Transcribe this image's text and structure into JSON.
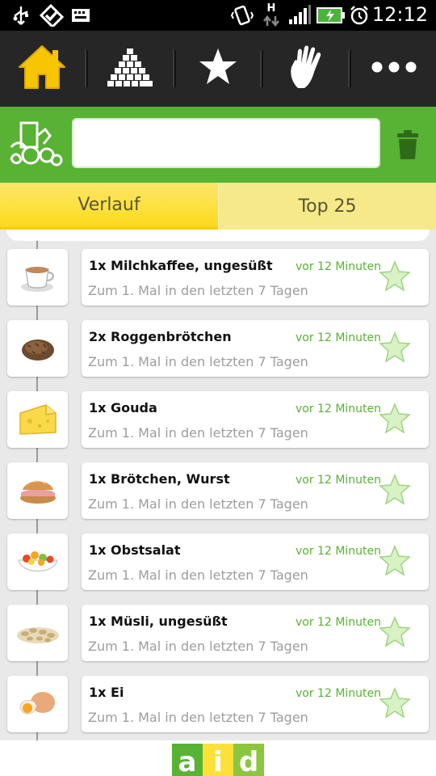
{
  "status_bar": {
    "time": "12:12",
    "network_label": "H",
    "icons": [
      "usb-icon",
      "tasks-check-icon",
      "keyboard-icon",
      "vibrate-icon",
      "data-arrows-icon",
      "signal-icon",
      "battery-charging-icon",
      "alarm-icon"
    ]
  },
  "nav": {
    "items": [
      {
        "name": "home-icon",
        "active": true
      },
      {
        "name": "food-pyramid-icon",
        "active": false
      },
      {
        "name": "star-icon",
        "active": false
      },
      {
        "name": "hand-icon",
        "active": false
      },
      {
        "name": "more-dots-icon",
        "active": false
      }
    ]
  },
  "search": {
    "value": "",
    "placeholder": "",
    "logo_icon": "food-basket-icon",
    "trash_icon": "trash-icon"
  },
  "tabs": [
    {
      "label": "Verlauf",
      "active": true
    },
    {
      "label": "Top 25",
      "active": false
    }
  ],
  "colors": {
    "green": "#58b233",
    "yellow": "#fde13a",
    "nav_bg": "#262626",
    "subtle_text": "#9d9d9d"
  },
  "entries": [
    {
      "title": "1x Milchkaffee, ungesüßt",
      "time": "vor 12 Minuten",
      "subtitle": "Zum 1. Mal in den letzten 7 Tagen",
      "image": "coffee-icon"
    },
    {
      "title": "2x Roggenbrötchen",
      "time": "vor 12 Minuten",
      "subtitle": "Zum 1. Mal in den letzten 7 Tagen",
      "image": "rye-roll-icon"
    },
    {
      "title": "1x Gouda",
      "time": "vor 12 Minuten",
      "subtitle": "Zum 1. Mal in den letzten 7 Tagen",
      "image": "cheese-icon"
    },
    {
      "title": "1x Brötchen, Wurst",
      "time": "vor 12 Minuten",
      "subtitle": "Zum 1. Mal in den letzten 7 Tagen",
      "image": "sandwich-icon"
    },
    {
      "title": "1x Obstsalat",
      "time": "vor 12 Minuten",
      "subtitle": "Zum 1. Mal in den letzten 7 Tagen",
      "image": "fruit-salad-icon"
    },
    {
      "title": "1x Müsli, ungesüßt",
      "time": "vor 12 Minuten",
      "subtitle": "Zum 1. Mal in den letzten 7 Tagen",
      "image": "muesli-icon"
    },
    {
      "title": "1x Ei",
      "time": "vor 12 Minuten",
      "subtitle": "Zum 1. Mal in den letzten 7 Tagen",
      "image": "egg-icon"
    }
  ],
  "footer": {
    "logo_letters": [
      "a",
      "i",
      "d"
    ]
  }
}
